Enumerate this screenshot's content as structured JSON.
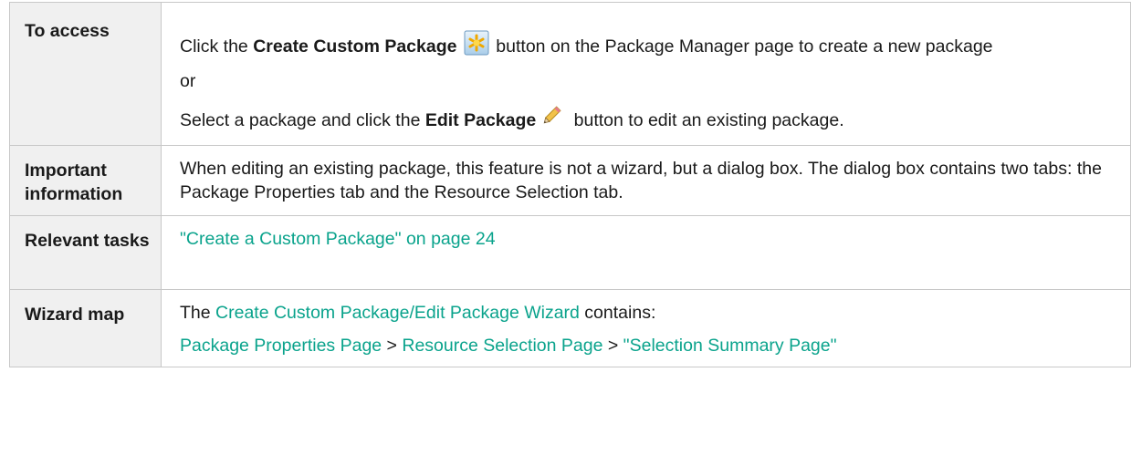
{
  "rows": [
    {
      "heading": "To access",
      "line1": {
        "pre": "Click the ",
        "bold": "Create Custom Package",
        "post": " button on the Package Manager page to create a new package",
        "icon": "create-package-icon"
      },
      "or": "or",
      "line2": {
        "pre": "Select a package and click the ",
        "bold": "Edit Package",
        "post": " button to edit an existing package.",
        "icon": "pencil-icon"
      }
    },
    {
      "heading": "Important information",
      "text": "When editing an existing package, this feature is not a wizard, but a dialog box. The dialog box contains two tabs: the Package Properties tab and the Resource Selection tab."
    },
    {
      "heading": "Relevant tasks",
      "link": "\"Create a Custom Package\" on page 24"
    },
    {
      "heading": "Wizard map",
      "line1": {
        "pre": "The ",
        "link": "Create Custom Package/Edit Package Wizard",
        "post": " contains:"
      },
      "line2": {
        "link1": "Package Properties Page",
        "sep1": " > ",
        "link2": "Resource Selection Page",
        "sep2": " > ",
        "link3": "\"Selection Summary Page\""
      }
    }
  ],
  "colors": {
    "link": "#0aa38c",
    "header_bg": "#f0f0f0",
    "border": "#c8c8c8"
  }
}
